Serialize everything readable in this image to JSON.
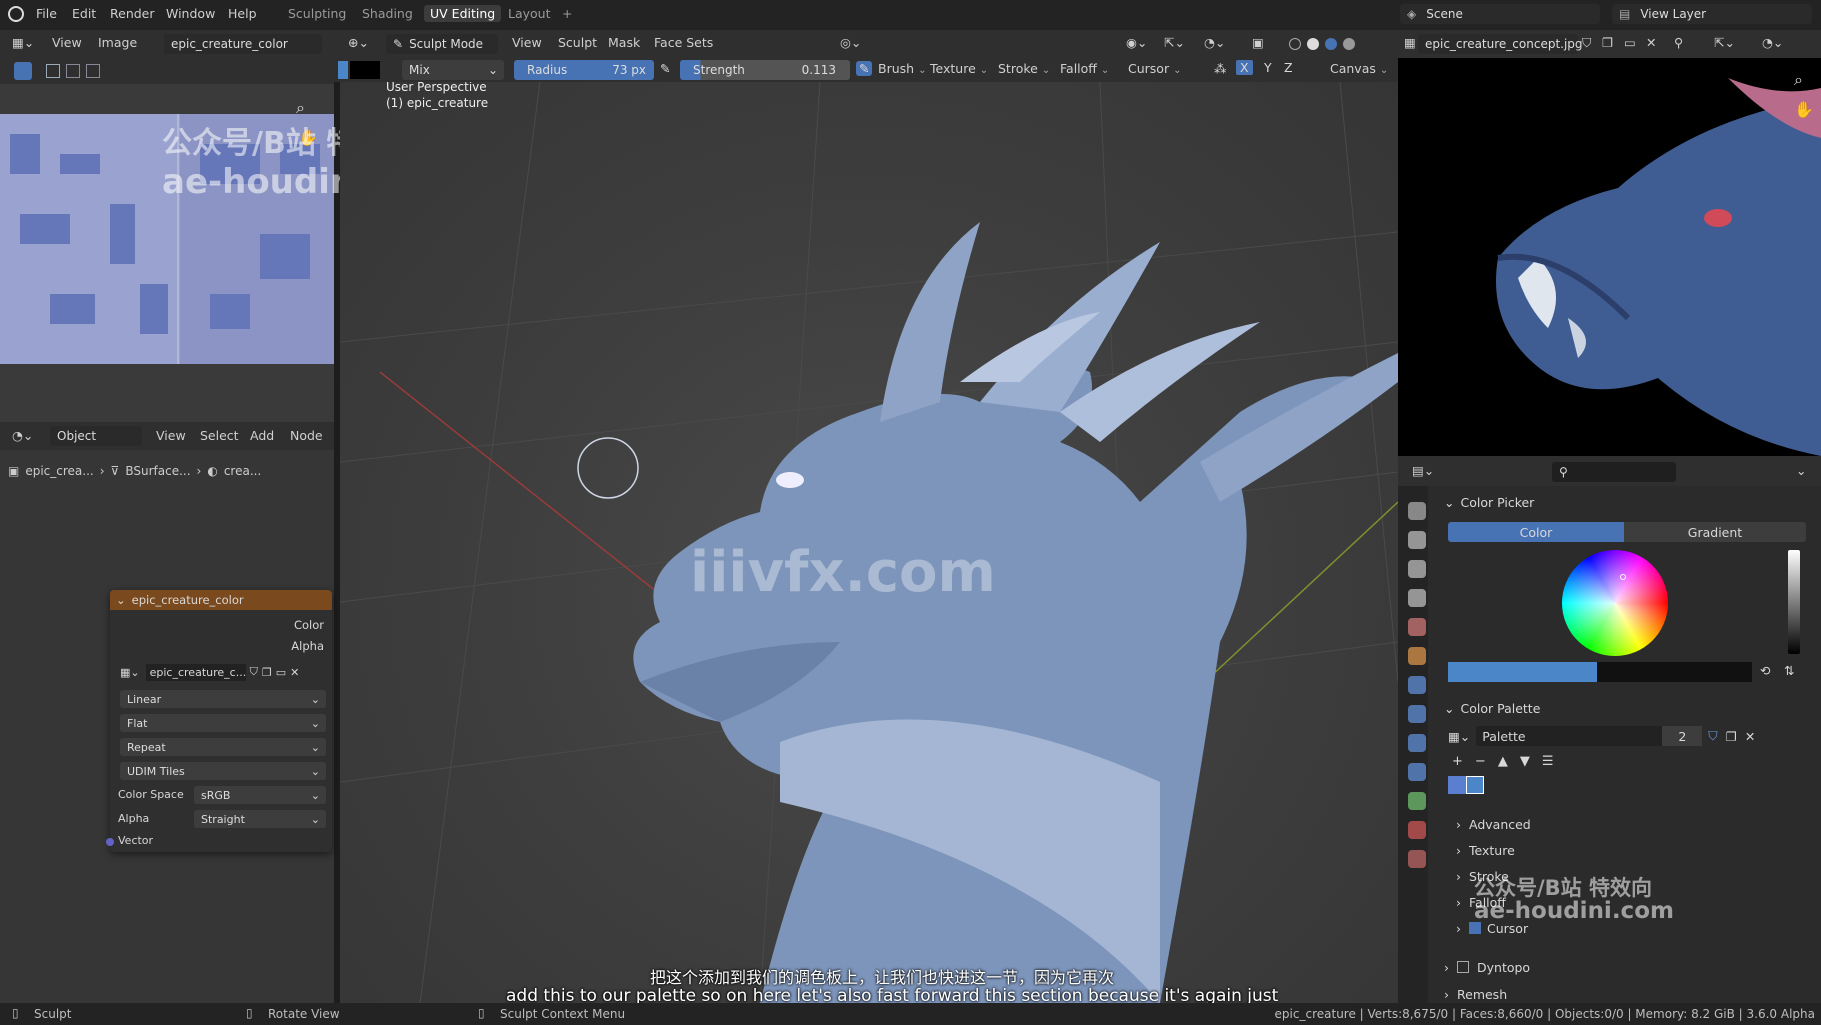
{
  "topbar": {
    "menus": [
      "File",
      "Edit",
      "Render",
      "Window",
      "Help"
    ],
    "workspaces": [
      "Sculpting",
      "Shading",
      "UV Editing",
      "Layout"
    ],
    "active_workspace": "UV Editing",
    "add_tab": "+",
    "scene_label": "Scene",
    "view_layer_label": "View Layer"
  },
  "image_editor": {
    "view": "View",
    "image": "Image",
    "image_name": "epic_creature_color"
  },
  "node_editor": {
    "mode": "Object",
    "menus": [
      "View",
      "Select",
      "Add",
      "Node"
    ],
    "breadcrumb": [
      "epic_crea...",
      "BSurface...",
      "crea..."
    ],
    "node_title": "epic_creature_color",
    "out_color": "Color",
    "out_alpha": "Alpha",
    "image_field": "epic_creature_c...",
    "interpolation": "Linear",
    "projection": "Flat",
    "extension": "Repeat",
    "source": "UDIM Tiles",
    "color_space_label": "Color Space",
    "color_space": "sRGB",
    "alpha_label": "Alpha",
    "alpha_mode": "Straight",
    "vector_socket": "Vector"
  },
  "viewport_header": {
    "mode": "Sculpt Mode",
    "menus": [
      "View",
      "Sculpt",
      "Mask",
      "Face Sets"
    ],
    "blend": "Mix",
    "radius_label": "Radius",
    "radius_value": "73 px",
    "strength_label": "Strength",
    "strength_value": "0.113",
    "dropdowns": [
      "Brush",
      "Texture",
      "Stroke",
      "Falloff",
      "Cursor"
    ],
    "axes": [
      "X",
      "Y",
      "Z"
    ],
    "canvas": "Canvas"
  },
  "viewport": {
    "perspective": "User Perspective",
    "object": "(1) epic_creature"
  },
  "reference": {
    "image_name": "epic_creature_concept.jpg"
  },
  "properties": {
    "color_picker_title": "Color Picker",
    "tab_color": "Color",
    "tab_gradient": "Gradient",
    "color_palette_title": "Color Palette",
    "palette_name": "Palette",
    "palette_users": "2",
    "sections": [
      "Advanced",
      "Texture",
      "Stroke",
      "Falloff",
      "Cursor"
    ],
    "dyntopo": "Dyntopo",
    "remesh": "Remesh"
  },
  "colors": {
    "accent": "#4772b3",
    "header_orange": "#7a4a1e",
    "swatch_1": "#5a7fd0",
    "swatch_2": "#4a86c8"
  },
  "watermarks": {
    "wm1_line1": "公众号/B站 特效向",
    "wm1_line2": "ae-houdini.com",
    "wm_center": "iiivfx.com",
    "wm2_line1": "公众号/B站 特效向",
    "wm2_line2": "ae-houdini.com"
  },
  "subtitles": {
    "zh": "把这个添加到我们的调色板上，让我们也快进这一节，因为它再次",
    "en": "add this to our palette so on here let's also fast forward this section because it's again just"
  },
  "statusbar": {
    "left": "Sculpt",
    "middle": "Rotate View",
    "context": "Sculpt Context Menu",
    "stats": "epic_creature | Verts:8,675/0 | Faces:8,660/0 | Objects:0/0 | Memory: 8.2 GiB | 3.6.0 Alpha"
  }
}
